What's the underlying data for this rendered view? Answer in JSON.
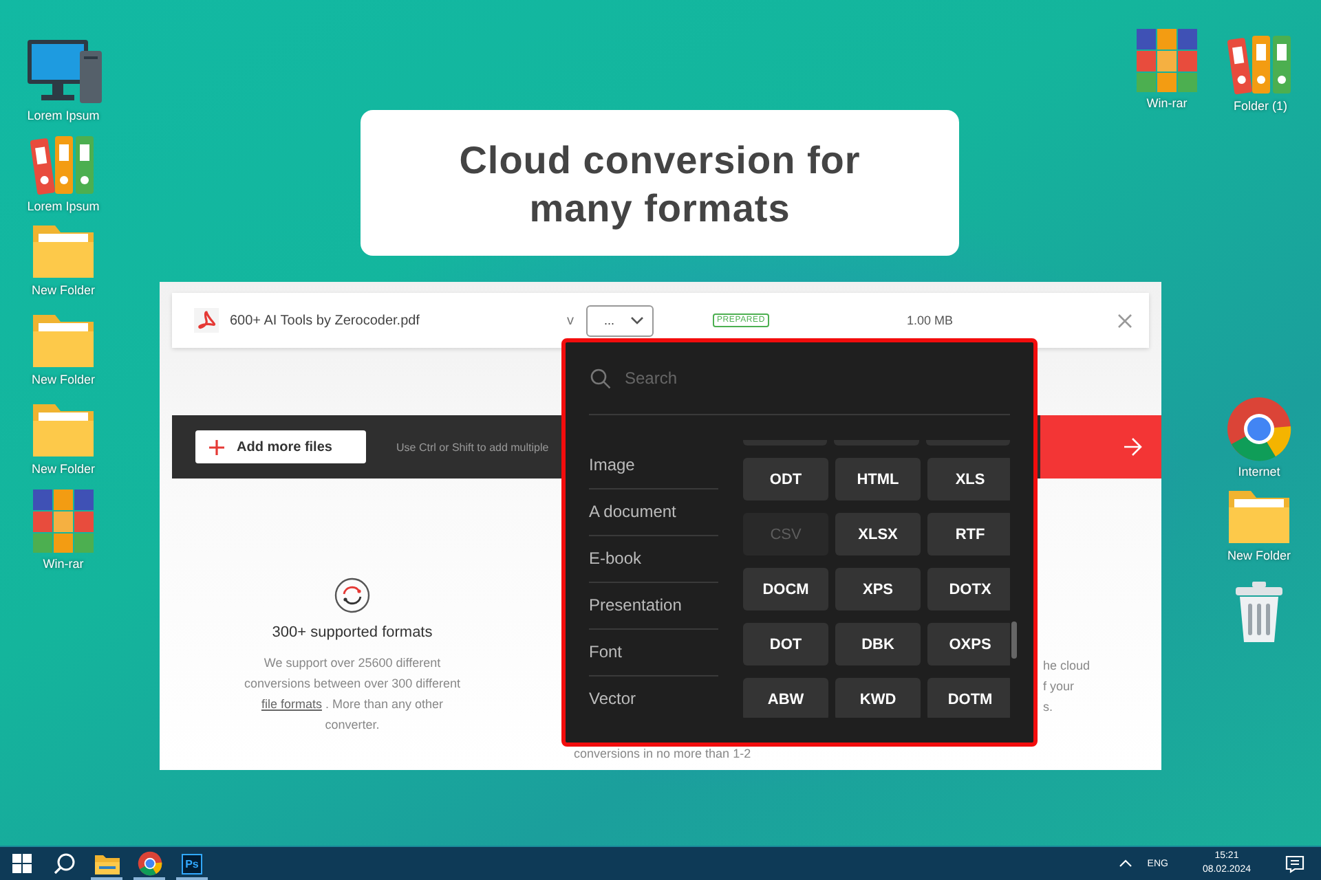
{
  "desktop": {
    "left_icons": [
      {
        "kind": "computer",
        "label": "Lorem Ipsum"
      },
      {
        "kind": "binders",
        "label": "Lorem Ipsum"
      },
      {
        "kind": "folder",
        "label": "New Folder"
      },
      {
        "kind": "folder",
        "label": "New Folder"
      },
      {
        "kind": "folder",
        "label": "New Folder"
      },
      {
        "kind": "archive",
        "label": "Win-rar"
      }
    ],
    "right_icons": [
      {
        "kind": "archive",
        "label": "Win-rar"
      },
      {
        "kind": "binders",
        "label": "Folder (1)"
      },
      {
        "kind": "browser",
        "label": "Internet"
      },
      {
        "kind": "folder",
        "label": "New Folder"
      },
      {
        "kind": "trash"
      }
    ]
  },
  "headline": [
    "Cloud conversion for",
    "many formats"
  ],
  "converter": {
    "file": {
      "name": "600+ AI Tools by Zerocoder.pdf",
      "version_label": "v",
      "format_value": "...",
      "status": "PREPARED",
      "size": "1.00 MB"
    },
    "add_button": "Add more files",
    "hint": "Use Ctrl or Shift to add multiple",
    "feature": {
      "title": "300+ supported formats",
      "text_before": "We support over 25600 different conversions between over 300 different ",
      "link": "file formats",
      "text_after": " . More than any other converter."
    },
    "middle_fragment": "conversions in no more than 1-2",
    "right_fragments": [
      "he cloud",
      "f your",
      "s."
    ],
    "dropdown": {
      "search_placeholder": "Search",
      "categories": [
        "Image",
        "A document",
        "E-book",
        "Presentation",
        "Font",
        "Vector"
      ],
      "formats": [
        {
          "label": "ODT",
          "disabled": false
        },
        {
          "label": "HTML",
          "disabled": false
        },
        {
          "label": "XLS",
          "disabled": false
        },
        {
          "label": "CSV",
          "disabled": true
        },
        {
          "label": "XLSX",
          "disabled": false
        },
        {
          "label": "RTF",
          "disabled": false
        },
        {
          "label": "DOCM",
          "disabled": false
        },
        {
          "label": "XPS",
          "disabled": false
        },
        {
          "label": "DOTX",
          "disabled": false
        },
        {
          "label": "DOT",
          "disabled": false
        },
        {
          "label": "DBK",
          "disabled": false
        },
        {
          "label": "OXPS",
          "disabled": false
        },
        {
          "label": "ABW",
          "disabled": false
        },
        {
          "label": "KWD",
          "disabled": false
        },
        {
          "label": "DOTM",
          "disabled": false
        }
      ]
    }
  },
  "taskbar": {
    "apps": [
      {
        "kind": "start",
        "running": false
      },
      {
        "kind": "search",
        "running": false
      },
      {
        "kind": "files",
        "running": true
      },
      {
        "kind": "browser",
        "running": true
      },
      {
        "kind": "photoshop",
        "label": "Ps",
        "running": true
      }
    ],
    "language": "ENG",
    "time": "15:21",
    "date": "08.02.2024"
  }
}
